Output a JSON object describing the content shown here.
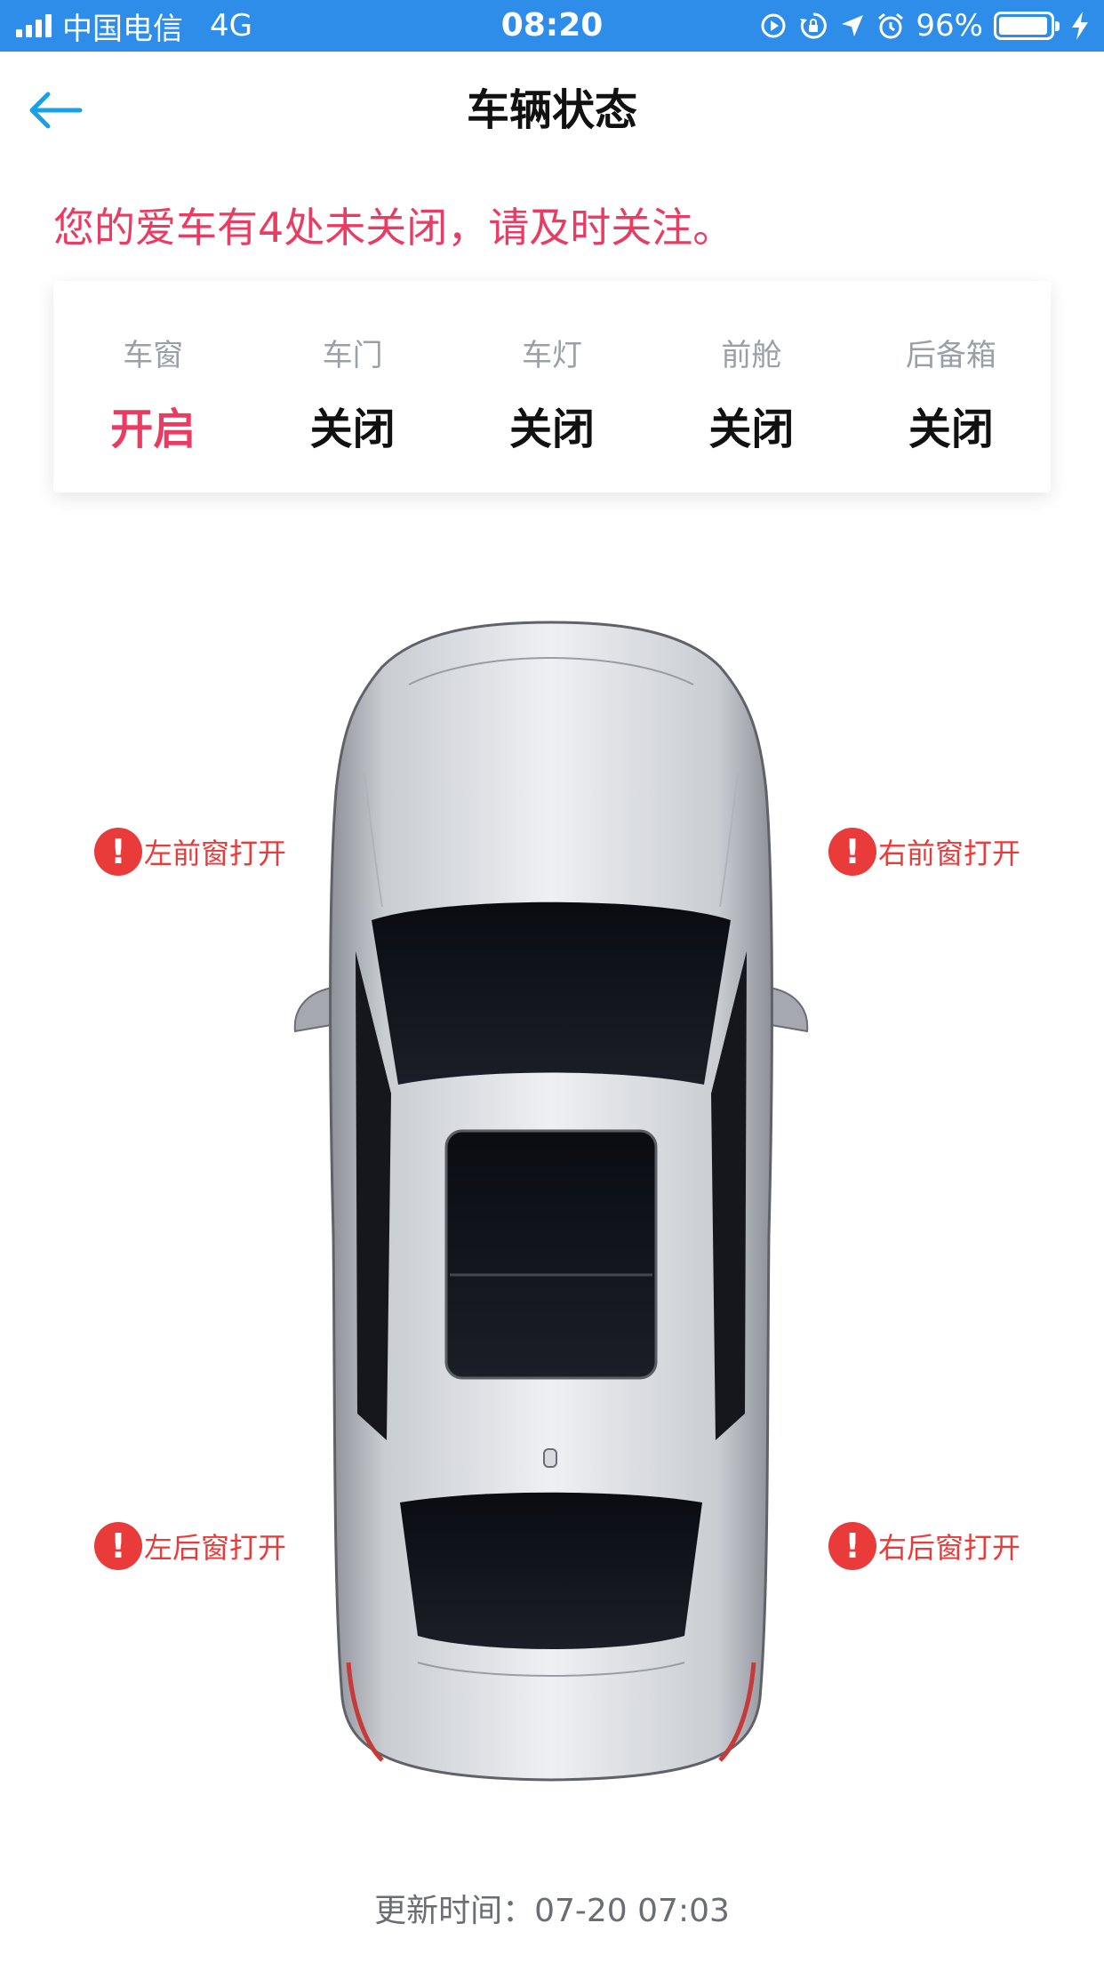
{
  "status_bar": {
    "carrier": "中国电信",
    "network": "4G",
    "time": "08:20",
    "battery_text": "96%",
    "battery_level": 0.96
  },
  "nav": {
    "title": "车辆状态"
  },
  "alert_text": "您的爱车有4处未关闭，请及时关注。",
  "status_items": [
    {
      "label": "车窗",
      "value": "开启",
      "open": true
    },
    {
      "label": "车门",
      "value": "关闭",
      "open": false
    },
    {
      "label": "车灯",
      "value": "关闭",
      "open": false
    },
    {
      "label": "前舱",
      "value": "关闭",
      "open": false
    },
    {
      "label": "后备箱",
      "value": "关闭",
      "open": false
    }
  ],
  "warnings": {
    "front_left": "左前窗打开",
    "front_right": "右前窗打开",
    "rear_left": "左后窗打开",
    "rear_right": "右后窗打开",
    "icon_glyph": "!"
  },
  "update_time": "更新时间：07-20 07:03",
  "colors": {
    "status_bar": "#2d8de8",
    "accent": "#1aa0e6",
    "alert": "#ea3b62",
    "warning": "#ea3b3b"
  }
}
